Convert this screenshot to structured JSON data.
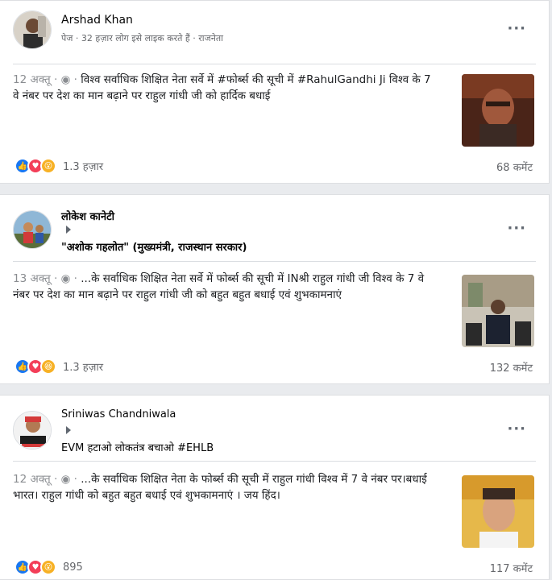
{
  "posts": [
    {
      "author": "Arshad Khan",
      "subtitle": "पेज · 32 हज़ार लोग इसे लाइक करते हैं · राजनेता",
      "date": "12 अक्तू",
      "text": "विश्व सर्वाधिक शिक्षित नेता सर्वे में #फोर्ब्स की सूची में #RahulGandhi Ji विश्व के 7 वे नंबर पर देश का मान बढ़ाने पर राहुल गांधी जी को हार्दिक बधाई",
      "reactions_count": "1.3 हज़ार",
      "comments": "68 कमेंट",
      "reaction_icons": [
        "like-icon",
        "love-icon",
        "wow-icon"
      ]
    },
    {
      "author": "लोकेश कानेटी",
      "target": "\"अशोक गहलोत\" (मुख्यमंत्री, राजस्थान सरकार)",
      "date": "13 अक्तू",
      "text": "...के सर्वाधिक शिक्षित नेता सर्वे में फोर्ब्स की सूची में INश्री राहुल गांधी जी विश्व के 7 वे नंबर पर देश का मान बढ़ाने पर राहुल गांधी जी को बहुत बहुत बधाई एवं शुभकामनाएं",
      "reactions_count": "1.3 हज़ार",
      "comments": "132 कमेंट",
      "reaction_icons": [
        "like-icon",
        "love-icon",
        "haha-icon"
      ]
    },
    {
      "author": "Sriniwas Chandniwala",
      "target": "EVM हटाओ लोकतंत्र बचाओ #EHLB",
      "date": "12 अक्तू",
      "text": "...के सर्वाधिक शिक्षित नेता के फोर्ब्स की सूची में राहुल गांधी विश्व में 7 वे नंबर पर।बधाई भारत। राहुल गांधी को बहुत बहुत बधाई एवं शुभकामनाएं । जय हिंद।",
      "reactions_count": "895",
      "comments": "117 कमेंट",
      "reaction_icons": [
        "like-icon",
        "love-icon",
        "wow-icon"
      ]
    }
  ],
  "more_label": "···",
  "date_sep": " · ",
  "globe_icon": "globe-icon"
}
